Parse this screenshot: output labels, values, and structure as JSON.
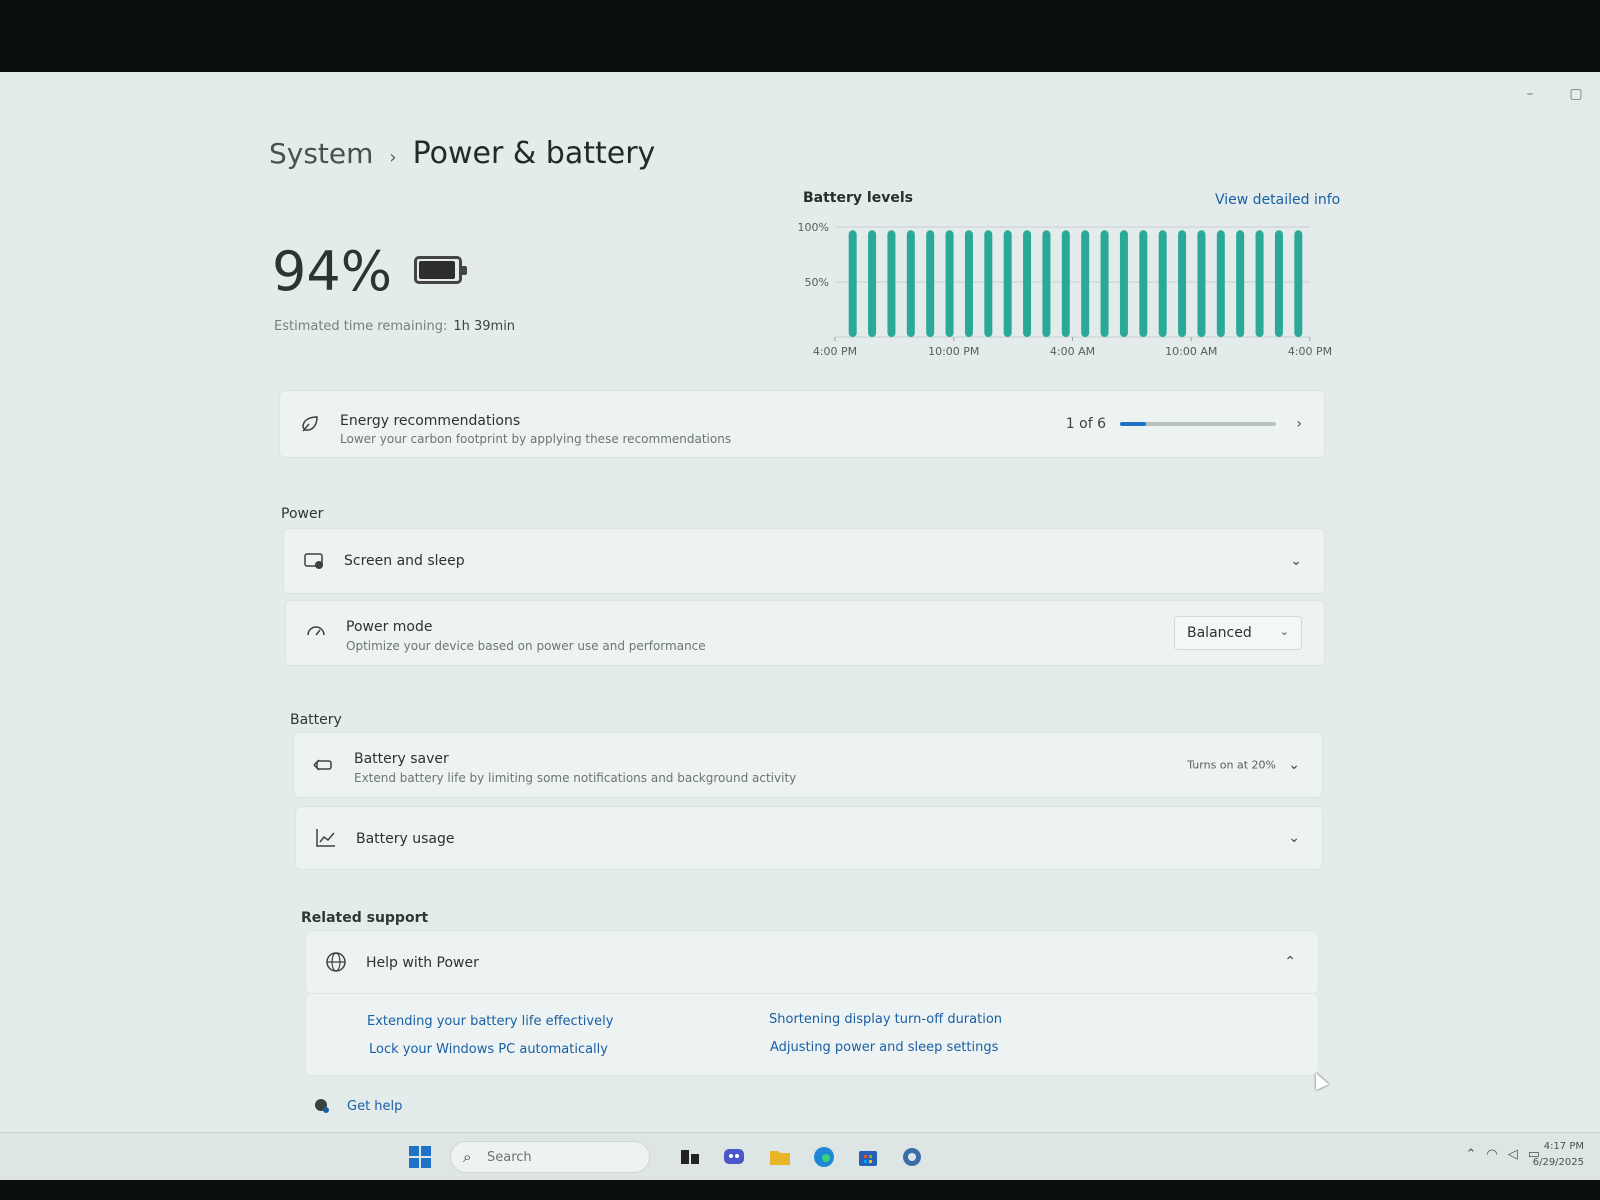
{
  "window": {
    "controls": [
      "–",
      "▢"
    ]
  },
  "breadcrumb": {
    "parent": "System",
    "separator": "›",
    "current": "Power & battery"
  },
  "battery": {
    "percent_label": "94%",
    "level": 0.94,
    "estimated_label": "Estimated time remaining:",
    "estimated_value": "1h 39min"
  },
  "chart": {
    "title": "Battery levels",
    "link": "View detailed info"
  },
  "chart_data": {
    "type": "bar",
    "title": "Battery levels",
    "yticks": [
      "100%",
      "50%"
    ],
    "xticks": [
      "4:00 PM",
      "10:00 PM",
      "4:00 AM",
      "10:00 AM",
      "4:00 PM"
    ],
    "ylim": [
      0,
      100
    ],
    "values": [
      97,
      97,
      97,
      97,
      97,
      97,
      97,
      97,
      97,
      97,
      97,
      97,
      97,
      97,
      97,
      97,
      97,
      97,
      97,
      97,
      97,
      97,
      97,
      97
    ],
    "color": "#2aa99a",
    "grid": true
  },
  "energy": {
    "title": "Energy recommendations",
    "subtitle": "Lower your carbon footprint by applying these recommendations",
    "progress_label": "1 of 6",
    "progress": 0.1667
  },
  "power": {
    "section": "Power",
    "screen_sleep": {
      "title": "Screen and sleep"
    },
    "power_mode": {
      "title": "Power mode",
      "subtitle": "Optimize your device based on power use and performance",
      "value": "Balanced"
    }
  },
  "battery_section": {
    "section": "Battery",
    "saver": {
      "title": "Battery saver",
      "subtitle": "Extend battery life by limiting some notifications and background activity",
      "status": "Turns on at 20%"
    },
    "usage": {
      "title": "Battery usage"
    }
  },
  "support": {
    "section": "Related support",
    "help": {
      "title": "Help with Power"
    },
    "links": [
      "Extending your battery life effectively",
      "Shortening display turn-off duration",
      "Lock your Windows PC automatically",
      "Adjusting power and sleep settings"
    ],
    "get_help": "Get help"
  },
  "taskbar": {
    "search_placeholder": "Search",
    "time": "4:17 PM",
    "date": "6/29/2025",
    "colors": {
      "start": "#1f73c7",
      "edge": "#1e88d6",
      "explorer": "#e8b628",
      "store": "#2561b8",
      "settings": "#3d6ea8"
    }
  }
}
